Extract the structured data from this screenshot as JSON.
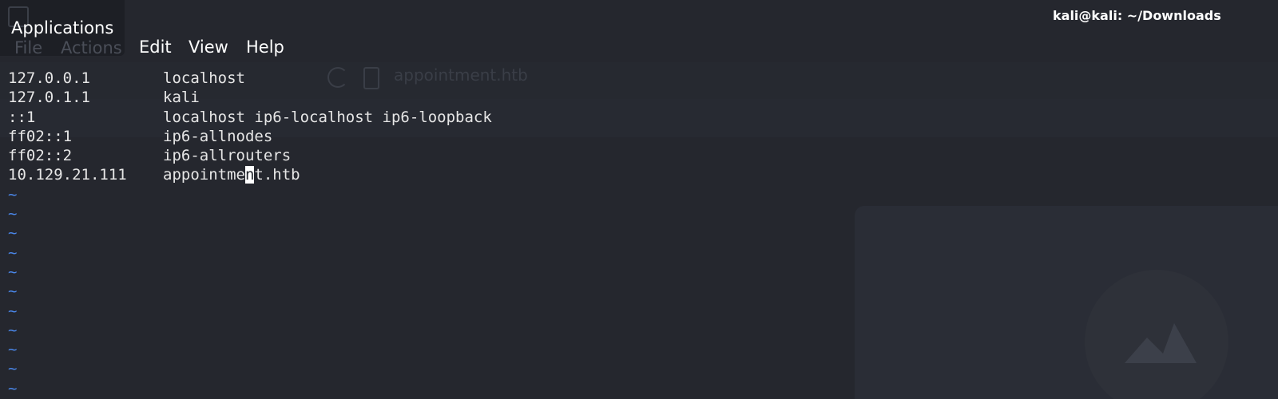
{
  "panel": {
    "applications_label": "Applications",
    "window_title": "kali@kali: ~/Downloads"
  },
  "menu": {
    "ghost_file": "File",
    "ghost_actions": "Actions",
    "edit": "Edit",
    "view": "View",
    "help": "Help"
  },
  "background": {
    "url_text": "appointment.htb"
  },
  "editor": {
    "lines": [
      {
        "address": "127.0.0.1",
        "hosts": "localhost"
      },
      {
        "address": "127.0.1.1",
        "hosts": "kali"
      },
      {
        "address": "::1",
        "hosts": "localhost ip6-localhost ip6-loopback"
      },
      {
        "address": "ff02::1",
        "hosts": "ip6-allnodes"
      },
      {
        "address": "ff02::2",
        "hosts": "ip6-allrouters"
      },
      {
        "address": "10.129.21.111",
        "hosts_before_cursor": "appointme",
        "cursor_char": "n",
        "hosts_after_cursor": "t.htb"
      }
    ],
    "tilde": "~",
    "tilde_count": 11
  }
}
